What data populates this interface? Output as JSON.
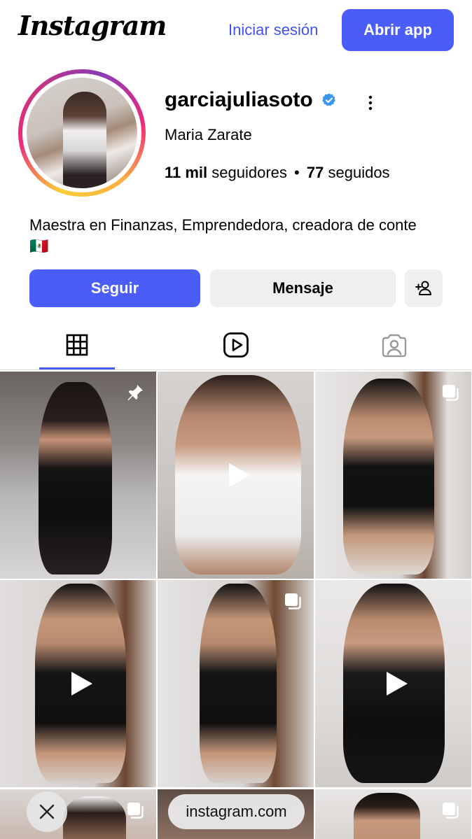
{
  "header": {
    "logo_text": "Instagram",
    "login_label": "Iniciar sesión",
    "open_app_label": "Abrir app"
  },
  "profile": {
    "username": "garciajuliasoto",
    "verified": true,
    "full_name": "Maria Zarate",
    "followers_value": "11 mil",
    "followers_label": "seguidores",
    "separator": "•",
    "following_value": "77",
    "following_label": "seguidos",
    "bio_text": "Maestra en Finanzas, Emprendedora, creadora de conte",
    "bio_flag": "🇲🇽"
  },
  "actions": {
    "follow_label": "Seguir",
    "message_label": "Mensaje"
  },
  "tabs": [
    {
      "icon": "grid-icon",
      "active": true
    },
    {
      "icon": "reels-icon",
      "active": false
    },
    {
      "icon": "tagged-icon",
      "active": false
    }
  ],
  "posts": [
    {
      "type": "pinned"
    },
    {
      "type": "video"
    },
    {
      "type": "carousel"
    },
    {
      "type": "video"
    },
    {
      "type": "carousel"
    },
    {
      "type": "video"
    },
    {
      "type": "carousel"
    },
    {
      "type": "unknown"
    },
    {
      "type": "carousel"
    }
  ],
  "browser": {
    "url": "instagram.com"
  },
  "colors": {
    "accent": "#4a5df9",
    "link": "#4150f7",
    "verified": "#3897f0",
    "button_secondary": "#efefef"
  }
}
